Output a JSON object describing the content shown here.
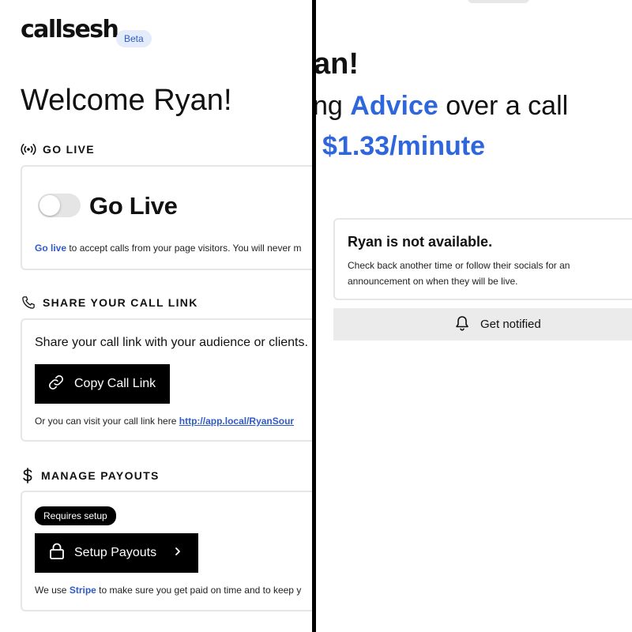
{
  "left": {
    "logo": "callsesh",
    "beta_badge": "Beta",
    "welcome": "Welcome Ryan!",
    "go_live_section": {
      "heading": "GO LIVE",
      "title": "Go Live",
      "toggle_on": false,
      "desc_link": "Go live",
      "desc_rest": " to accept calls from your page visitors. You will never m"
    },
    "share_section": {
      "heading": "SHARE YOUR CALL LINK",
      "text": "Share your call link with your audience or clients.",
      "button_label": "Copy Call Link",
      "visit_prefix": "Or you can visit your call link here ",
      "visit_link": "http://app.local/RyanSour"
    },
    "payout_section": {
      "heading": "MANAGE PAYOUTS",
      "status_pill": "Requires setup",
      "button_label": "Setup Payouts",
      "desc_prefix": "We use ",
      "desc_link": "Stripe",
      "desc_rest": " to make sure you get paid on time and to keep y"
    }
  },
  "right": {
    "heading_fragment": "an!",
    "subheading_prefix": "ng ",
    "subheading_accent": "Advice",
    "subheading_suffix": " over a call",
    "price": "$1.33/minute",
    "unavailable_card": {
      "title": "Ryan is not available.",
      "description": "Check back another time or follow their socials for an announcement on when they will be live."
    },
    "notify_button": "Get notified"
  },
  "colors": {
    "accent": "#2f66dc",
    "link": "#2f5bc8",
    "badge_bg": "#e4ecfb",
    "button_bg": "#000000",
    "card_border": "#e6e6e6",
    "notify_bg": "#ebebeb"
  },
  "icons": [
    "broadcast-icon",
    "phone-icon",
    "dollar-icon",
    "link-icon",
    "lock-icon",
    "chevron-right-icon",
    "bell-icon"
  ]
}
